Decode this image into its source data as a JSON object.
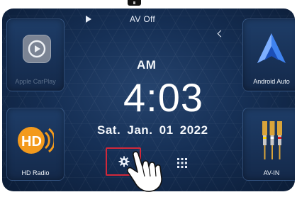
{
  "status_bar": {
    "source_label": "AV Off"
  },
  "tiles": {
    "carplay": {
      "label": "Apple CarPlay",
      "icon": "carplay-icon"
    },
    "android_auto": {
      "label": "Android Auto",
      "icon": "android-auto-icon"
    },
    "hd_radio": {
      "label": "HD Radio",
      "icon": "hd-radio-icon"
    },
    "av_in": {
      "label": "AV-IN",
      "icon": "av-in-icon"
    }
  },
  "clock": {
    "ampm": "AM",
    "time": "4:03",
    "date": "Sat.  Jan. 01  2022"
  },
  "dock": {
    "settings_icon": "gear-icon",
    "apps_icon": "grid-icon"
  },
  "colors": {
    "background": "#163056",
    "highlight": "#d2283a",
    "android_blue": "#3f83f0",
    "hd_orange": "#f39a1c"
  }
}
